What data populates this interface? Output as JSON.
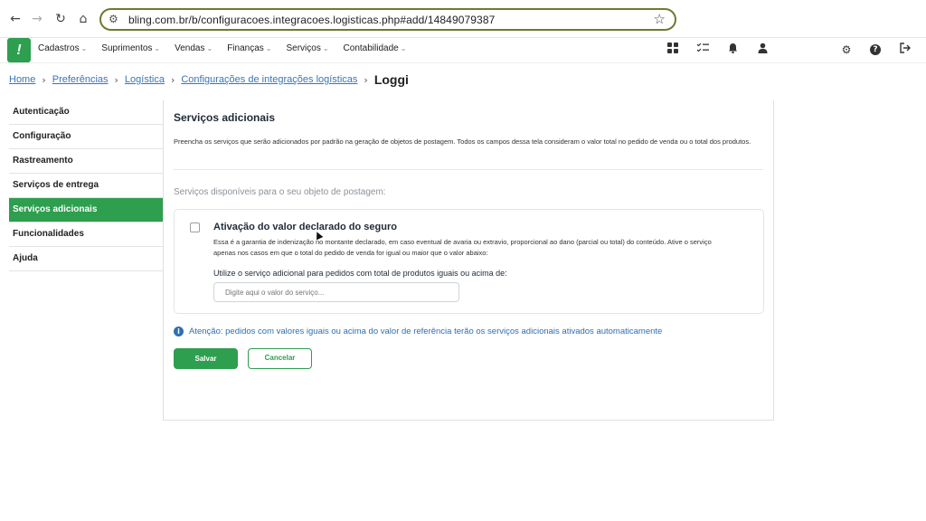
{
  "browser": {
    "url": "bling.com.br/b/configuracoes.integracoes.logisticas.php#add/14849079387"
  },
  "header": {
    "menu": [
      {
        "label": "Cadastros"
      },
      {
        "label": "Suprimentos"
      },
      {
        "label": "Vendas"
      },
      {
        "label": "Finanças"
      },
      {
        "label": "Serviços"
      },
      {
        "label": "Contabilidade"
      }
    ],
    "logo_glyph": "!",
    "help_glyph": "?",
    "brand_color": "#2e9e4f"
  },
  "breadcrumb": {
    "items": [
      "Home",
      "Preferências",
      "Logística",
      "Configurações de integrações logísticas"
    ],
    "current": "Loggi"
  },
  "sidebar": {
    "items": [
      {
        "label": "Autenticação"
      },
      {
        "label": "Configuração"
      },
      {
        "label": "Rastreamento"
      },
      {
        "label": "Serviços de entrega"
      },
      {
        "label": "Serviços adicionais",
        "active": true
      },
      {
        "label": "Funcionalidades"
      },
      {
        "label": "Ajuda"
      }
    ]
  },
  "main": {
    "title": "Serviços adicionais",
    "description": "Preencha os serviços que serão adicionados por padrão na geração de objetos de postagem. Todos os campos dessa tela consideram o valor total no pedido de venda ou o total dos produtos.",
    "section_title": "Serviços disponíveis para o seu objeto de postagem:",
    "service": {
      "title": "Ativação do valor declarado do seguro",
      "description": "Essa é a garantia de indenização no montante declarado, em caso eventual de avaria ou extravio, proporcional ao dano (parcial ou total) do conteúdo. Ative o serviço apenas nos casos em que o total do pedido de venda for igual ou maior que o valor abaixo:",
      "input_label": "Utilize o serviço adicional para pedidos com total de produtos iguais ou acima de:",
      "input_placeholder": "Digite aqui o valor do serviço...",
      "input_value": "",
      "checked": false
    },
    "info_text": "Atenção: pedidos com valores iguais ou acima do valor de referência terão os serviços adicionais ativados automaticamente",
    "save_label": "Salvar",
    "cancel_label": "Cancelar"
  }
}
